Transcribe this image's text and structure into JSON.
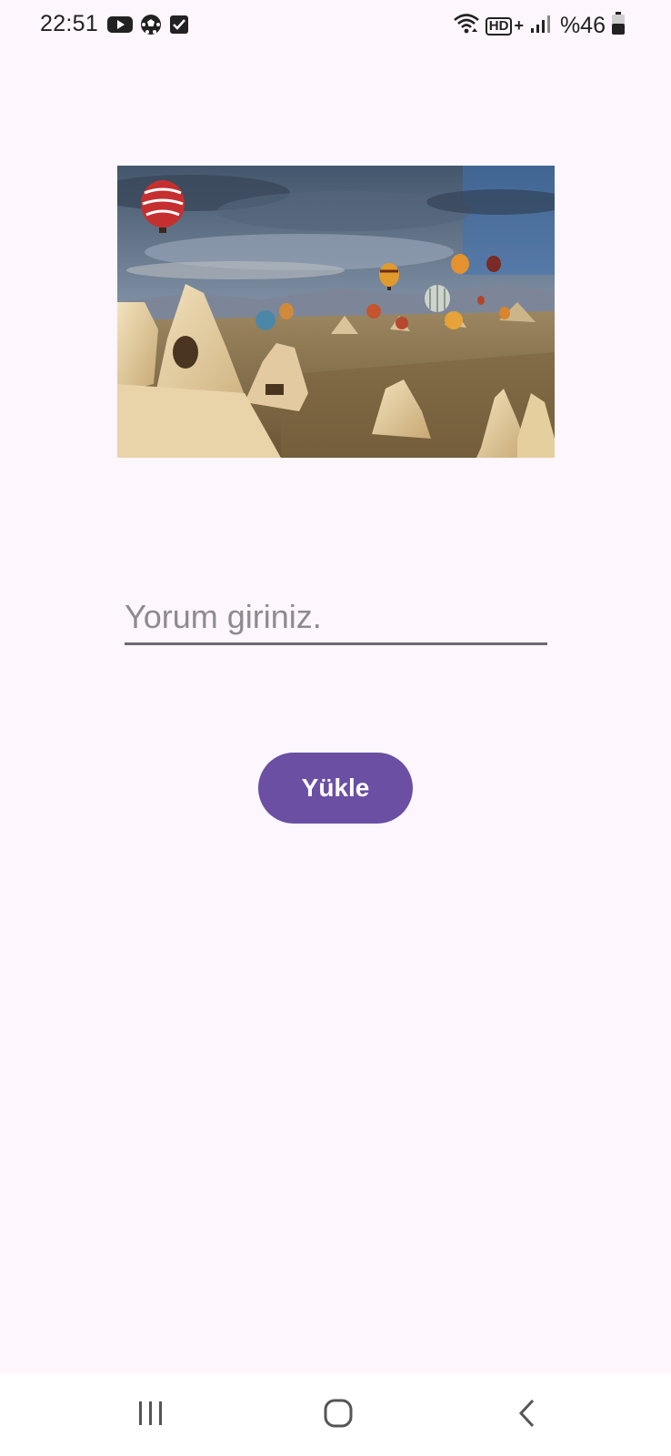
{
  "status_bar": {
    "time": "22:51",
    "battery": "%46",
    "network_type": "HD",
    "network_plus": "+",
    "left_icons": [
      "youtube-icon",
      "football-icon",
      "checkbox-icon"
    ],
    "right_icons": [
      "wifi-icon",
      "hd-signal-icon",
      "cell-signal-icon",
      "battery-icon"
    ]
  },
  "content": {
    "comment_placeholder": "Yorum giriniz.",
    "comment_value": "",
    "upload_label": "Yükle"
  },
  "nav_bar": {
    "buttons": [
      "recent-apps-icon",
      "home-icon",
      "back-icon"
    ]
  },
  "colors": {
    "background": "#fdf7fd",
    "button": "#6a4fa3",
    "button_text": "#ffffff",
    "underline": "#6f6774",
    "placeholder": "#8e8a91"
  }
}
